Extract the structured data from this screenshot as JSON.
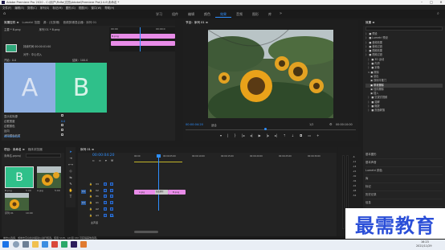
{
  "app": {
    "title": "Adobe Premiere Pro 2020 - C:\\用户\\Fidfa\\文档\\Adobe\\Premiere Pro\\14.0\\未命名 *",
    "menu": [
      "文件(F)",
      "编辑(E)",
      "剪辑(C)",
      "序列(S)",
      "标记(M)",
      "图形(G)",
      "视图(V)",
      "窗口(W)",
      "帮助(H)"
    ]
  },
  "workspaces": {
    "tabs": [
      "学习",
      "组件",
      "编辑",
      "颜色",
      "效果",
      "音频",
      "图形",
      "库"
    ],
    "active_index": 4
  },
  "effect_controls": {
    "tabs": [
      "效果控件 ≡",
      "Lumetri 范围",
      "源：(无剪辑)",
      "音频剪辑混合器：序列 01"
    ],
    "clip_label": "主要 * B.png",
    "seq_label": "序列 01 * B.png",
    "mini_clip_label": "B.png",
    "ruler_time_left": "00:00",
    "ruler_time_right": "00:00:0",
    "rows": [
      "〉 fx 运动",
      "〉 fx 不透明度",
      "〉 时间重映射",
      "〉 fx 渐变擦除",
      "过渡完成",
      "自定义..."
    ],
    "transition_prop": "持续时间  00:00:01:00",
    "align_label": "对齐：中心切入",
    "start": "开始：0.0",
    "end": "结束：100.0",
    "tile_a": "A",
    "tile_b": "B",
    "checkbox_rows": [
      "显示实际源",
      "边框宽度",
      "边框颜色",
      "反向",
      "消除锯齿品质"
    ],
    "border_width_value": "0.0",
    "time_bottom": "00:00:04:20"
  },
  "program_monitor": {
    "tab": "节目：序列 01 ≡",
    "timecode_left": "00:00:04:20",
    "fit": "适合",
    "ratio": "1/2",
    "timecode_right": "00:00:10:00"
  },
  "effects_panel": {
    "title": "效果 ≡",
    "tree": [
      "〉 ■ 预设",
      "〉 ■ Lumetri 预设",
      "〉 ■ 音频效果",
      "〉 ■ 音频过渡",
      "〉 ■ 视频效果",
      "〉 ■ 视频过渡",
      "   〉 ■ 3D 运动",
      "   〉 ■ 内滑",
      "   〉 ■ 划像",
      "   ∨ ■ 擦除",
      "      ▣ 划出",
      "      ▣ 双侧平推门",
      "      ▣ 带状擦除",
      "      ▣ 径向擦除",
      "      ▣ 插入",
      "   〉 ■ 沉浸式视频",
      "   〉 ■ 溶解",
      "   〉 ■ 缩放",
      "   〉 ■ 页面剥落"
    ],
    "selected_index": 12,
    "bottom_items": [
      "基本图形",
      "基本声音",
      "Lumetri 颜色",
      "库",
      "标记",
      "历史记录",
      "信息"
    ]
  },
  "project_panel": {
    "tabs": [
      "项目：未命名 ≡",
      "媒体浏览器"
    ],
    "name": "未命名.prproj",
    "items": [
      {
        "label": "B.png",
        "duration": "5:00"
      },
      {
        "label": "A.jpg",
        "duration": "5:00"
      },
      {
        "label": "序列 01",
        "duration": "10:00"
      }
    ]
  },
  "timeline": {
    "tab": "序列 01 ≡",
    "timecode": "00:00:04:20",
    "ruler_labels": [
      "00:00",
      "00:00:05:00",
      "00:00:10:00",
      "00:00:15:00",
      "00:00:20:00",
      "00:00:25:00",
      "00:00:30:00"
    ],
    "tracks": [
      "V3",
      "V2",
      "V1",
      "A1",
      "A2",
      "A3",
      "主声道"
    ],
    "master_value": "0.0",
    "clip_a": "A.jpg",
    "clip_b": "B.png",
    "transition": "渐变擦除",
    "audio_meter_labels": [
      "-6",
      "-12",
      "-18",
      "-24",
      "-30",
      "-36",
      "-42",
      "-48",
      "-54"
    ]
  },
  "status_bar": {
    "text": "单击以选择，或单击空白处并拖动以进行框选。使用 Shift、Alt 和 Ctrl 可获得其他选项。"
  },
  "watermark": {
    "text": "最需教育"
  },
  "taskbar": {
    "time": "16:23",
    "date": "2021/11/29"
  }
}
